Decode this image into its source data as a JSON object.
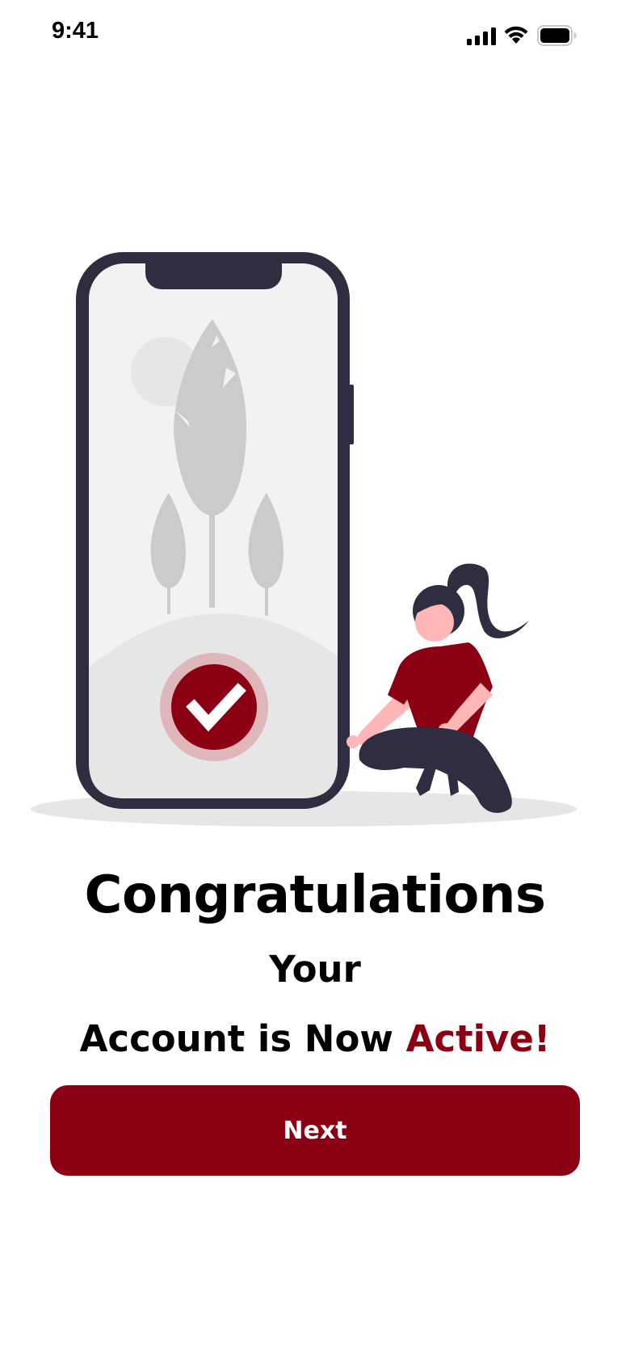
{
  "status_bar": {
    "time": "9:41",
    "icons": [
      "signal-icon",
      "wifi-icon",
      "battery-icon"
    ]
  },
  "illustration": {
    "subject": "person-with-phone-checkmark",
    "icons": [
      "phone-icon",
      "check-icon",
      "tree-icon",
      "sun-icon",
      "person-icon"
    ]
  },
  "headline": {
    "word1": "Congratulations",
    "word2": " Your",
    "line2_prefix": "Account is Now ",
    "line2_accent": "Active!"
  },
  "actions": {
    "next_label": "Next"
  },
  "colors": {
    "accent": "#8c0013",
    "dark": "#2f2e41",
    "skin": "#ffb6b6",
    "light_gray": "#e6e6e6",
    "mid_gray": "#cbcbcb"
  }
}
